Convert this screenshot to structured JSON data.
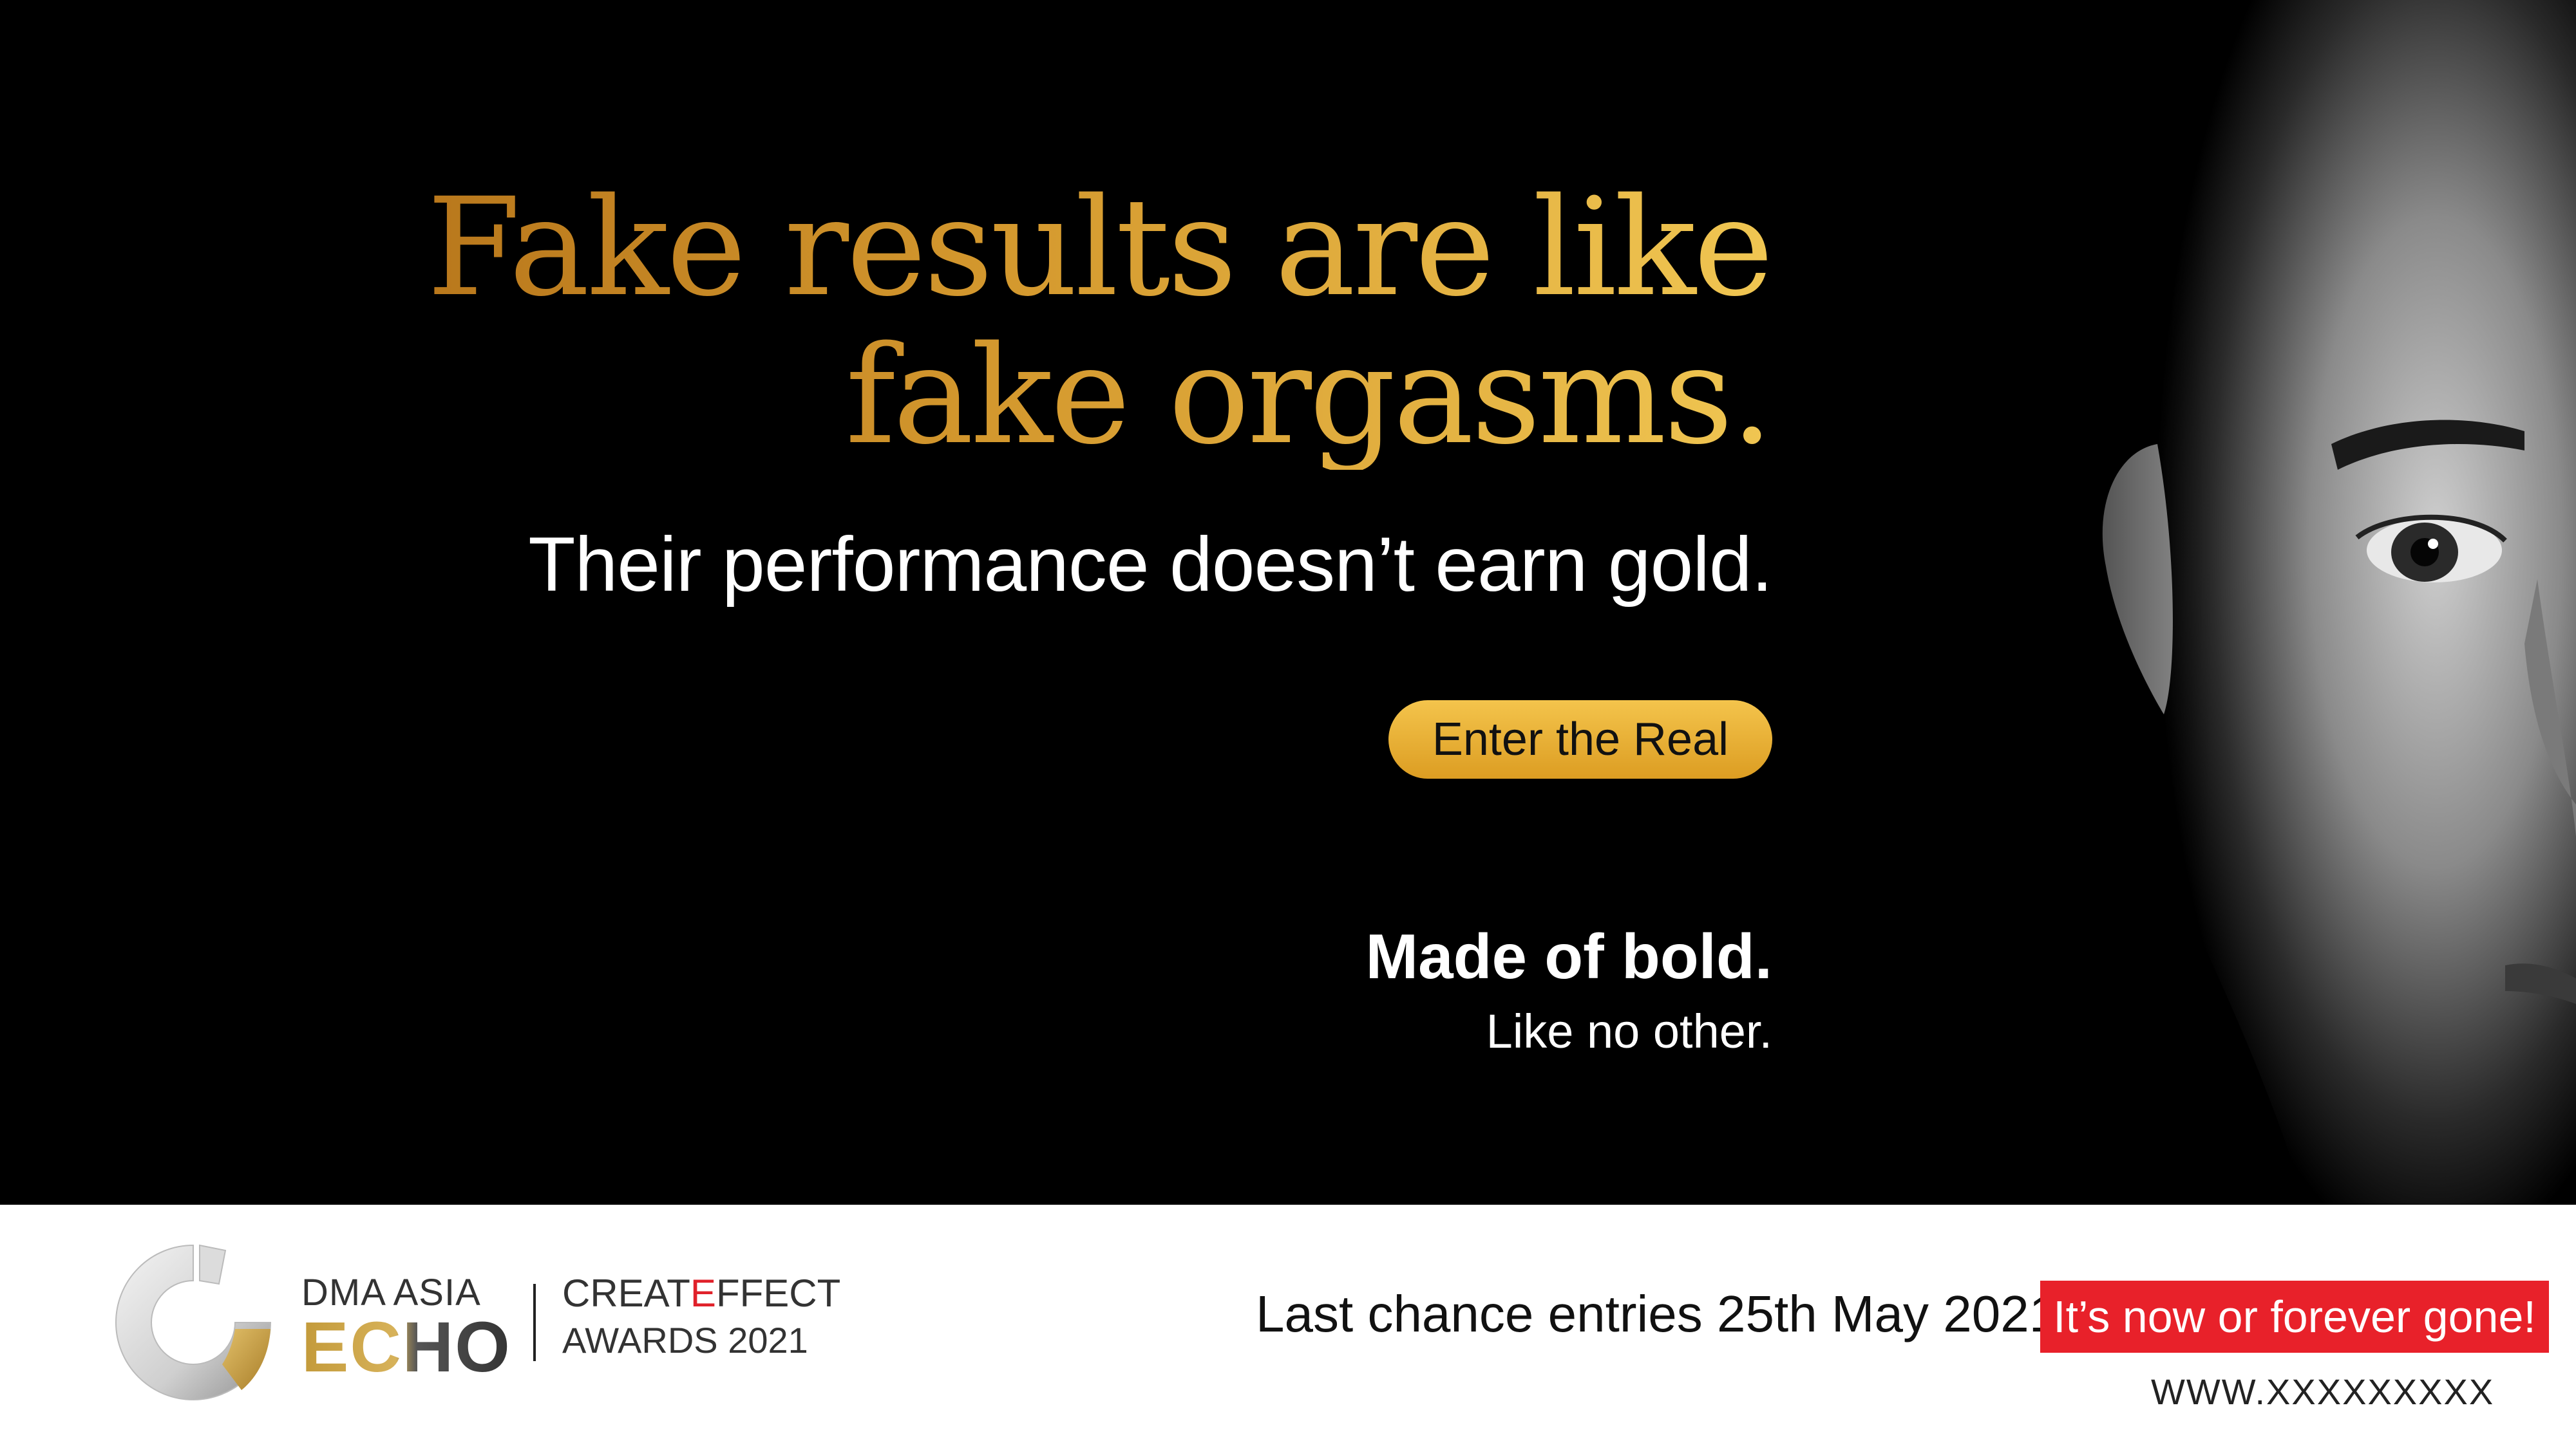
{
  "headline": {
    "line1": "Fake results are like",
    "line2": "fake orgasms."
  },
  "subheadline": "Their performance doesn’t earn gold.",
  "cta_label": "Enter the Real",
  "tagline": {
    "bold": "Made of bold.",
    "regular": "Like no other."
  },
  "footer": {
    "logo_line1": "DMA ASIA",
    "logo_line2": "ECHO",
    "award_name_a": "CREAT",
    "award_name_e": "E",
    "award_name_b": "FFECT",
    "award_year": "AWARDS 2021",
    "deadline": "Last chance entries 25th May 2021",
    "urgency": "It’s now or forever gone!",
    "url": "WWW.XXXXXXXXX"
  },
  "colors": {
    "gold_dark": "#b9781c",
    "gold_light": "#f0c652",
    "red": "#e8212a"
  },
  "icons": {
    "logo": "echo-ring-logo",
    "photo": "man-portrait-photo"
  }
}
